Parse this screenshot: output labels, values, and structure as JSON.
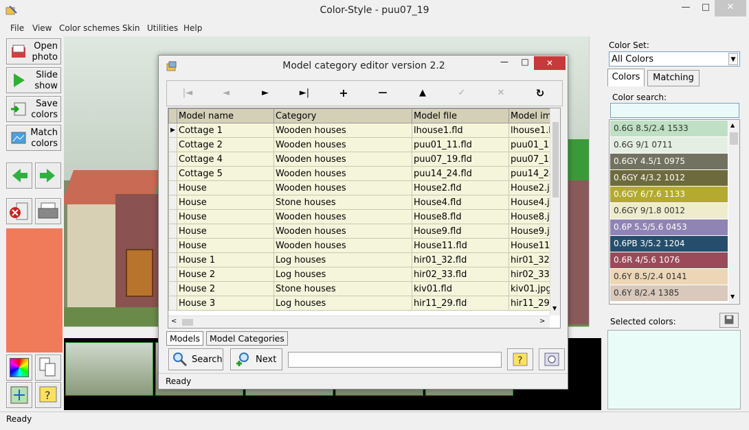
{
  "window": {
    "title": "Color-Style - puu07_19",
    "minimize": "—",
    "maximize": "□",
    "close": "✕"
  },
  "menu": [
    "File",
    "View",
    "Color schemes",
    "Skin",
    "Utilities",
    "Help"
  ],
  "toolbar": {
    "open_photo": [
      "Open",
      "photo"
    ],
    "slide_show": [
      "Slide",
      "show"
    ],
    "save_colors": [
      "Save",
      "colors"
    ],
    "match_colors": [
      "Match",
      "colors"
    ]
  },
  "current_color": "#ef7b5b",
  "right_panel": {
    "color_set_label": "Color Set:",
    "color_set_value": "All Colors",
    "tabs": [
      "Colors",
      "Matching"
    ],
    "color_search_label": "Color search:",
    "color_search_value": "",
    "colors": [
      {
        "name": "0.6G 8.5/2.4 1533",
        "hex": "#bfe0c4",
        "text": "#333333"
      },
      {
        "name": "0.6G 9/1 0711",
        "hex": "#e4eee2",
        "text": "#333333"
      },
      {
        "name": "0.6GY 4.5/1 0975",
        "hex": "#727260",
        "text": "#ffffff"
      },
      {
        "name": "0.6GY 4/3.2 1012",
        "hex": "#6d6b3d",
        "text": "#ffffff"
      },
      {
        "name": "0.6GY 6/7.6 1133",
        "hex": "#b3aa2f",
        "text": "#ffffff"
      },
      {
        "name": "0.6GY 9/1.8 0012",
        "hex": "#eeeccc",
        "text": "#333333"
      },
      {
        "name": "0.6P 5.5/5.6 0453",
        "hex": "#8f84b4",
        "text": "#ffffff"
      },
      {
        "name": "0.6PB 3/5.2 1204",
        "hex": "#264e6c",
        "text": "#ffffff"
      },
      {
        "name": "0.6R 4/5.6 1076",
        "hex": "#9a4a59",
        "text": "#ffffff"
      },
      {
        "name": "0.6Y 8.5/2.4 0141",
        "hex": "#ecd6b6",
        "text": "#333333"
      },
      {
        "name": "0.6Y 8/2.4 1385",
        "hex": "#d8c9bc",
        "text": "#333333"
      }
    ],
    "selected_label": "Selected colors:"
  },
  "status": "Ready",
  "dialog": {
    "title": "Model category editor version 2.2",
    "columns": [
      "Model name",
      "Category",
      "Model file",
      "Model im"
    ],
    "rows": [
      [
        "Cottage 1",
        "Wooden houses",
        "lhouse1.fld",
        "lhouse1.b"
      ],
      [
        "Cottage 2",
        "Wooden houses",
        "puu01_11.fld",
        "puu01_11"
      ],
      [
        "Cottage 4",
        "Wooden houses",
        "puu07_19.fld",
        "puu07_19"
      ],
      [
        "Cottage 5",
        "Wooden houses",
        "puu14_24.fld",
        "puu14_24"
      ],
      [
        "House",
        "Wooden houses",
        "House2.fld",
        "House2.jp"
      ],
      [
        "House",
        "Stone houses",
        "House4.fld",
        "House4.jp"
      ],
      [
        "House",
        "Wooden houses",
        "House8.fld",
        "House8.jp"
      ],
      [
        "House",
        "Wooden houses",
        "House9.fld",
        "House9.jp"
      ],
      [
        "House",
        "Wooden houses",
        "House11.fld",
        "House11"
      ],
      [
        "House 1",
        "Log houses",
        "hir01_32.fld",
        "hir01_32.j"
      ],
      [
        "House 2",
        "Log houses",
        "hir02_33.fld",
        "hir02_33.j"
      ],
      [
        "House 2",
        "Stone houses",
        "kiv01.fld",
        "kiv01.jpg"
      ],
      [
        "House 3",
        "Log houses",
        "hir11_29.fld",
        "hir11_29.j"
      ]
    ],
    "tabs": [
      "Models",
      "Model Categories"
    ],
    "search_label": "Search",
    "next_label": "Next",
    "search_value": "",
    "status": "Ready",
    "nav": [
      "|◄",
      "◄",
      "►",
      "►|",
      "+",
      "—",
      "▲",
      "✓",
      "✕",
      "↻"
    ]
  }
}
